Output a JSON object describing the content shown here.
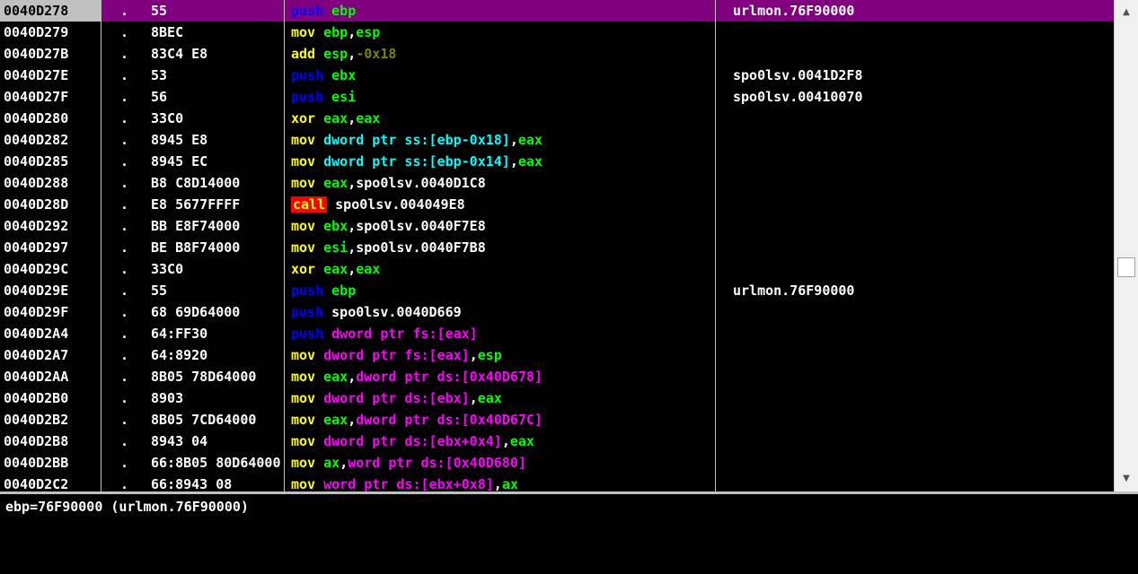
{
  "disassembly": {
    "rows": [
      {
        "addr": "0040D278",
        "dot": ".",
        "hex": "55",
        "comment": "urlmon.76F90000",
        "selected": true,
        "asm": [
          {
            "t": "push",
            "c": "mp"
          },
          {
            "t": " "
          },
          {
            "t": "ebp",
            "c": "r"
          }
        ]
      },
      {
        "addr": "0040D279",
        "dot": ".",
        "hex": "8BEC",
        "comment": "",
        "asm": [
          {
            "t": "mov",
            "c": "m"
          },
          {
            "t": " "
          },
          {
            "t": "ebp",
            "c": "r"
          },
          {
            "t": ",",
            "c": "sep"
          },
          {
            "t": "esp",
            "c": "r"
          }
        ]
      },
      {
        "addr": "0040D27B",
        "dot": ".",
        "hex": "83C4 E8",
        "comment": "",
        "asm": [
          {
            "t": "add",
            "c": "m"
          },
          {
            "t": " "
          },
          {
            "t": "esp",
            "c": "r"
          },
          {
            "t": ",",
            "c": "sep"
          },
          {
            "t": "-0x18",
            "c": "n"
          }
        ]
      },
      {
        "addr": "0040D27E",
        "dot": ".",
        "hex": "53",
        "comment": "spo0lsv.0041D2F8",
        "asm": [
          {
            "t": "push",
            "c": "mp"
          },
          {
            "t": " "
          },
          {
            "t": "ebx",
            "c": "r"
          }
        ]
      },
      {
        "addr": "0040D27F",
        "dot": ".",
        "hex": "56",
        "comment": "spo0lsv.00410070",
        "asm": [
          {
            "t": "push",
            "c": "mp"
          },
          {
            "t": " "
          },
          {
            "t": "esi",
            "c": "r"
          }
        ]
      },
      {
        "addr": "0040D280",
        "dot": ".",
        "hex": "33C0",
        "comment": "",
        "asm": [
          {
            "t": "xor",
            "c": "m"
          },
          {
            "t": " "
          },
          {
            "t": "eax",
            "c": "r"
          },
          {
            "t": ",",
            "c": "sep"
          },
          {
            "t": "eax",
            "c": "r"
          }
        ]
      },
      {
        "addr": "0040D282",
        "dot": ".",
        "hex": "8945 E8",
        "comment": "",
        "asm": [
          {
            "t": "mov",
            "c": "m"
          },
          {
            "t": " "
          },
          {
            "t": "dword ptr ss:[ebp-0x18]",
            "c": "mem"
          },
          {
            "t": ",",
            "c": "sep"
          },
          {
            "t": "eax",
            "c": "r"
          }
        ]
      },
      {
        "addr": "0040D285",
        "dot": ".",
        "hex": "8945 EC",
        "comment": "",
        "asm": [
          {
            "t": "mov",
            "c": "m"
          },
          {
            "t": " "
          },
          {
            "t": "dword ptr ss:[ebp-0x14]",
            "c": "mem"
          },
          {
            "t": ",",
            "c": "sep"
          },
          {
            "t": "eax",
            "c": "r"
          }
        ]
      },
      {
        "addr": "0040D288",
        "dot": ".",
        "hex": "B8 C8D14000",
        "comment": "",
        "asm": [
          {
            "t": "mov",
            "c": "m"
          },
          {
            "t": " "
          },
          {
            "t": "eax",
            "c": "r"
          },
          {
            "t": ",",
            "c": "sep"
          },
          {
            "t": "spo0lsv.0040D1C8",
            "c": "lit"
          }
        ]
      },
      {
        "addr": "0040D28D",
        "dot": ".",
        "hex": "E8 5677FFFF",
        "comment": "",
        "asm": [
          {
            "t": "call",
            "c": "mc"
          },
          {
            "t": " "
          },
          {
            "t": "spo0lsv.004049E8",
            "c": "lit"
          }
        ]
      },
      {
        "addr": "0040D292",
        "dot": ".",
        "hex": "BB E8F74000",
        "comment": "",
        "asm": [
          {
            "t": "mov",
            "c": "m"
          },
          {
            "t": " "
          },
          {
            "t": "ebx",
            "c": "r"
          },
          {
            "t": ",",
            "c": "sep"
          },
          {
            "t": "spo0lsv.0040F7E8",
            "c": "lit"
          }
        ]
      },
      {
        "addr": "0040D297",
        "dot": ".",
        "hex": "BE B8F74000",
        "comment": "",
        "asm": [
          {
            "t": "mov",
            "c": "m"
          },
          {
            "t": " "
          },
          {
            "t": "esi",
            "c": "r"
          },
          {
            "t": ",",
            "c": "sep"
          },
          {
            "t": "spo0lsv.0040F7B8",
            "c": "lit"
          }
        ]
      },
      {
        "addr": "0040D29C",
        "dot": ".",
        "hex": "33C0",
        "comment": "",
        "asm": [
          {
            "t": "xor",
            "c": "m"
          },
          {
            "t": " "
          },
          {
            "t": "eax",
            "c": "r"
          },
          {
            "t": ",",
            "c": "sep"
          },
          {
            "t": "eax",
            "c": "r"
          }
        ]
      },
      {
        "addr": "0040D29E",
        "dot": ".",
        "hex": "55",
        "comment": "urlmon.76F90000",
        "asm": [
          {
            "t": "push",
            "c": "mp"
          },
          {
            "t": " "
          },
          {
            "t": "ebp",
            "c": "r"
          }
        ]
      },
      {
        "addr": "0040D29F",
        "dot": ".",
        "hex": "68 69D64000",
        "comment": "",
        "asm": [
          {
            "t": "push",
            "c": "mp"
          },
          {
            "t": " "
          },
          {
            "t": "spo0lsv.0040D669",
            "c": "lit"
          }
        ]
      },
      {
        "addr": "0040D2A4",
        "dot": ".",
        "hex": "64:FF30",
        "comment": "",
        "asm": [
          {
            "t": "push",
            "c": "mp"
          },
          {
            "t": " "
          },
          {
            "t": "dword ptr fs:[eax]",
            "c": "memr"
          }
        ]
      },
      {
        "addr": "0040D2A7",
        "dot": ".",
        "hex": "64:8920",
        "comment": "",
        "asm": [
          {
            "t": "mov",
            "c": "m"
          },
          {
            "t": " "
          },
          {
            "t": "dword ptr fs:[eax]",
            "c": "memr"
          },
          {
            "t": ",",
            "c": "sep"
          },
          {
            "t": "esp",
            "c": "r"
          }
        ]
      },
      {
        "addr": "0040D2AA",
        "dot": ".",
        "hex": "8B05 78D64000",
        "comment": "",
        "asm": [
          {
            "t": "mov",
            "c": "m"
          },
          {
            "t": " "
          },
          {
            "t": "eax",
            "c": "r"
          },
          {
            "t": ",",
            "c": "sep"
          },
          {
            "t": "dword ptr ds:[0x40D678]",
            "c": "memr"
          }
        ]
      },
      {
        "addr": "0040D2B0",
        "dot": ".",
        "hex": "8903",
        "comment": "",
        "asm": [
          {
            "t": "mov",
            "c": "m"
          },
          {
            "t": " "
          },
          {
            "t": "dword ptr ds:[ebx]",
            "c": "memr"
          },
          {
            "t": ",",
            "c": "sep"
          },
          {
            "t": "eax",
            "c": "r"
          }
        ]
      },
      {
        "addr": "0040D2B2",
        "dot": ".",
        "hex": "8B05 7CD64000",
        "comment": "",
        "asm": [
          {
            "t": "mov",
            "c": "m"
          },
          {
            "t": " "
          },
          {
            "t": "eax",
            "c": "r"
          },
          {
            "t": ",",
            "c": "sep"
          },
          {
            "t": "dword ptr ds:[0x40D67C]",
            "c": "memr"
          }
        ]
      },
      {
        "addr": "0040D2B8",
        "dot": ".",
        "hex": "8943 04",
        "comment": "",
        "asm": [
          {
            "t": "mov",
            "c": "m"
          },
          {
            "t": " "
          },
          {
            "t": "dword ptr ds:[ebx+0x4]",
            "c": "memr"
          },
          {
            "t": ",",
            "c": "sep"
          },
          {
            "t": "eax",
            "c": "r"
          }
        ]
      },
      {
        "addr": "0040D2BB",
        "dot": ".",
        "hex": "66:8B05 80D64000",
        "comment": "",
        "asm": [
          {
            "t": "mov",
            "c": "m"
          },
          {
            "t": " "
          },
          {
            "t": "ax",
            "c": "r"
          },
          {
            "t": ",",
            "c": "sep"
          },
          {
            "t": "word ptr ds:[0x40D680]",
            "c": "memr"
          }
        ]
      },
      {
        "addr": "0040D2C2",
        "dot": ".",
        "hex": "66:8943 08",
        "comment": "",
        "asm": [
          {
            "t": "mov",
            "c": "m"
          },
          {
            "t": " "
          },
          {
            "t": "word ptr ds:[ebx+0x8]",
            "c": "memr"
          },
          {
            "t": ",",
            "c": "sep"
          },
          {
            "t": "ax",
            "c": "r"
          }
        ]
      }
    ]
  },
  "info_pane": {
    "text": "ebp=76F90000 (urlmon.76F90000)"
  },
  "scrollbar": {
    "up_icon": "▲",
    "down_icon": "▼",
    "thumb_position": 0.55
  },
  "colors": {
    "selected_row": "#800080",
    "call_highlight": "#ff0000",
    "push_mnemonic": "#0000ff",
    "mnemonic": "#ffff00",
    "register": "#00ff00"
  }
}
